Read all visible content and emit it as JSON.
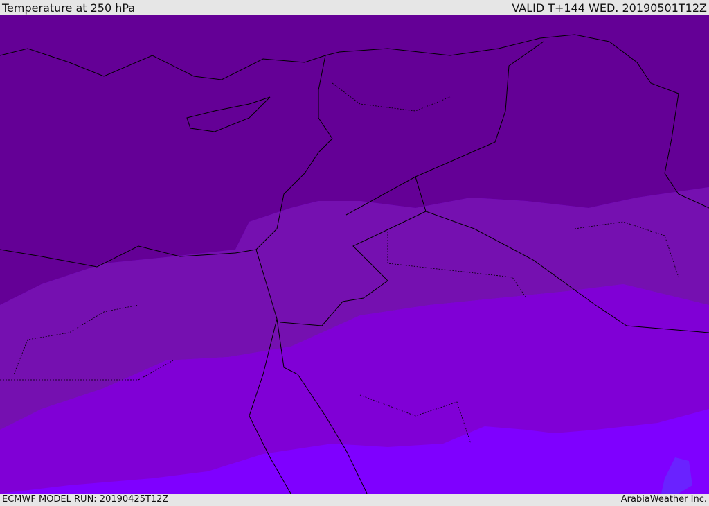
{
  "header": {
    "title": "Temperature at 250 hPa",
    "valid": "VALID T+144 WED. 20190501T12Z"
  },
  "footer": {
    "model_run": "ECMWF MODEL RUN: 20190425T12Z",
    "credit": "ArabiaWeather Inc."
  },
  "colors": {
    "band_coldest": "#640096",
    "band_cold": "#7510b0",
    "band_mid": "#8000d6",
    "band_warm": "#7f00ff",
    "band_warmest": "#6a22ff",
    "borders": "#000000"
  }
}
